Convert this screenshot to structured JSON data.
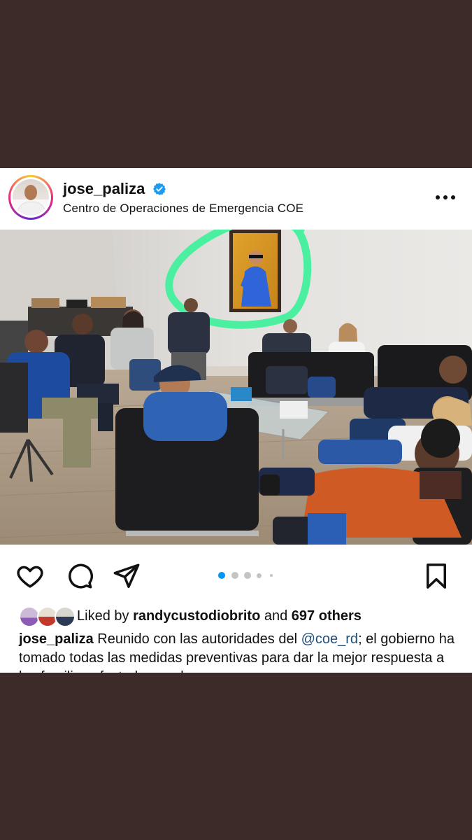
{
  "post": {
    "username": "jose_paliza",
    "location": "Centro de Operaciones de Emergencia COE",
    "verified_icon": "verified-badge-icon",
    "more_icon": "more-options-icon"
  },
  "actions": {
    "icons": [
      "heart-icon",
      "comment-icon",
      "share-icon",
      "bookmark-icon"
    ],
    "carousel_dots": 5,
    "carousel_active": 0
  },
  "likes": {
    "prefix": "Liked by",
    "user": "randycustodiobrito",
    "conjunction": "and",
    "others": "697 others"
  },
  "caption": {
    "username": "jose_paliza",
    "text_before": " Reunido con las autoridades del ",
    "mention": "@coe_rd",
    "text_after": "; el gobierno ha tomado todas las medidas preventivas para dar la mejor respuesta a las familias afectadas por la"
  },
  "colors": {
    "background": "#3c2b28",
    "highlight_circle": "#4af0a0",
    "verified_blue": "#1d9bf0",
    "carousel_active": "#0095f6"
  }
}
